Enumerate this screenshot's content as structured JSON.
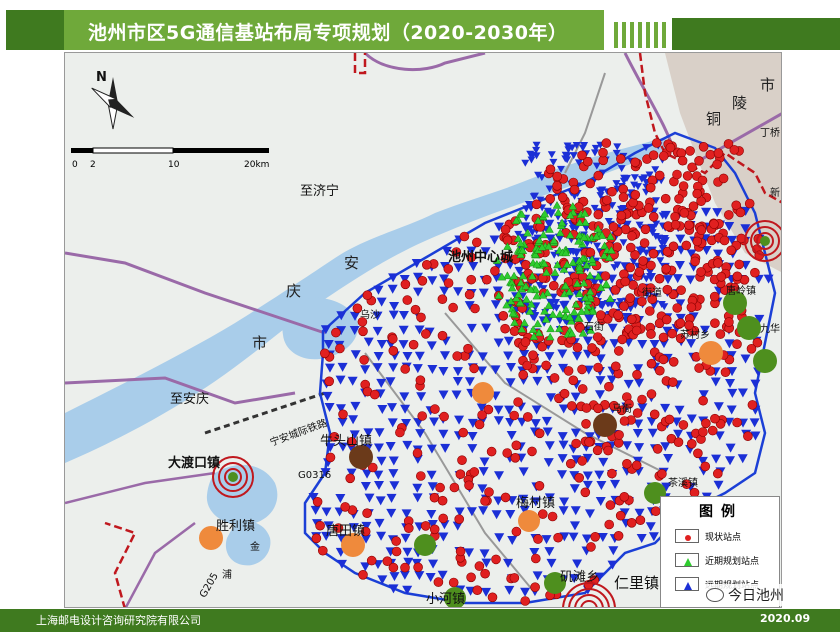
{
  "header": {
    "title": "池州市区5G通信基站布局专项规划（2020-2030年）"
  },
  "footer": {
    "org": "上海邮电设计咨询研究院有限公司",
    "date": "2020.09"
  },
  "watermark": {
    "text": "今日池州",
    "icon": "wechat-icon"
  },
  "map": {
    "north_label": "N",
    "scale": {
      "ticks": [
        "0",
        "2",
        "10",
        "20km"
      ]
    },
    "place_labels": {
      "zhi_jining": "至济宁",
      "zhi_anqing": "至安庆",
      "an": "安",
      "qing": "庆",
      "shi": "市",
      "chizhou_center": "池州中心城",
      "niutoushan": "牛头山镇",
      "daduko": "大渡口镇",
      "shengli": "胜利镇",
      "tangtian": "唐田镇",
      "meicun": "梅村镇",
      "mentan": "矶滩乡",
      "renli": "仁里镇",
      "xiaohe": "小河镇",
      "tangling": "唐岭镇",
      "jiuhua": "九华",
      "tongling_shi": "市",
      "ling": "陵",
      "tong": "铜",
      "dingqiao": "丁桥",
      "xin": "新",
      "sucun": "苏村乡",
      "chapu": "茶溪镇",
      "railway": "宁安城际铁路",
      "road_g0316": "G0316",
      "road_g205": "G205",
      "jin": "金",
      "pu": "浦",
      "chizhou_street": "街道",
      "shi_street": "石街",
      "wu": "乌沙",
      "ma": "马衙"
    }
  },
  "legend": {
    "title": "图例",
    "items": [
      {
        "label": "现状站点",
        "symbol": "red-dot",
        "color": "#e02020"
      },
      {
        "label": "近期规划站点",
        "symbol": "green-triangle",
        "color": "#2ecc2e"
      },
      {
        "label": "远期规划站点",
        "symbol": "blue-triangle",
        "color": "#1b2fd6"
      }
    ]
  },
  "colors": {
    "header_green": "#6fa93a",
    "dark_green": "#3f7a1f",
    "water_blue": "#9fc4e8",
    "boundary_red": "#c0181e",
    "district_blue": "#1b3fd6",
    "road_purple": "#9a6aa8",
    "site_red": "#e02020",
    "near_green": "#2ecc2e",
    "far_blue": "#1b2fd6"
  }
}
